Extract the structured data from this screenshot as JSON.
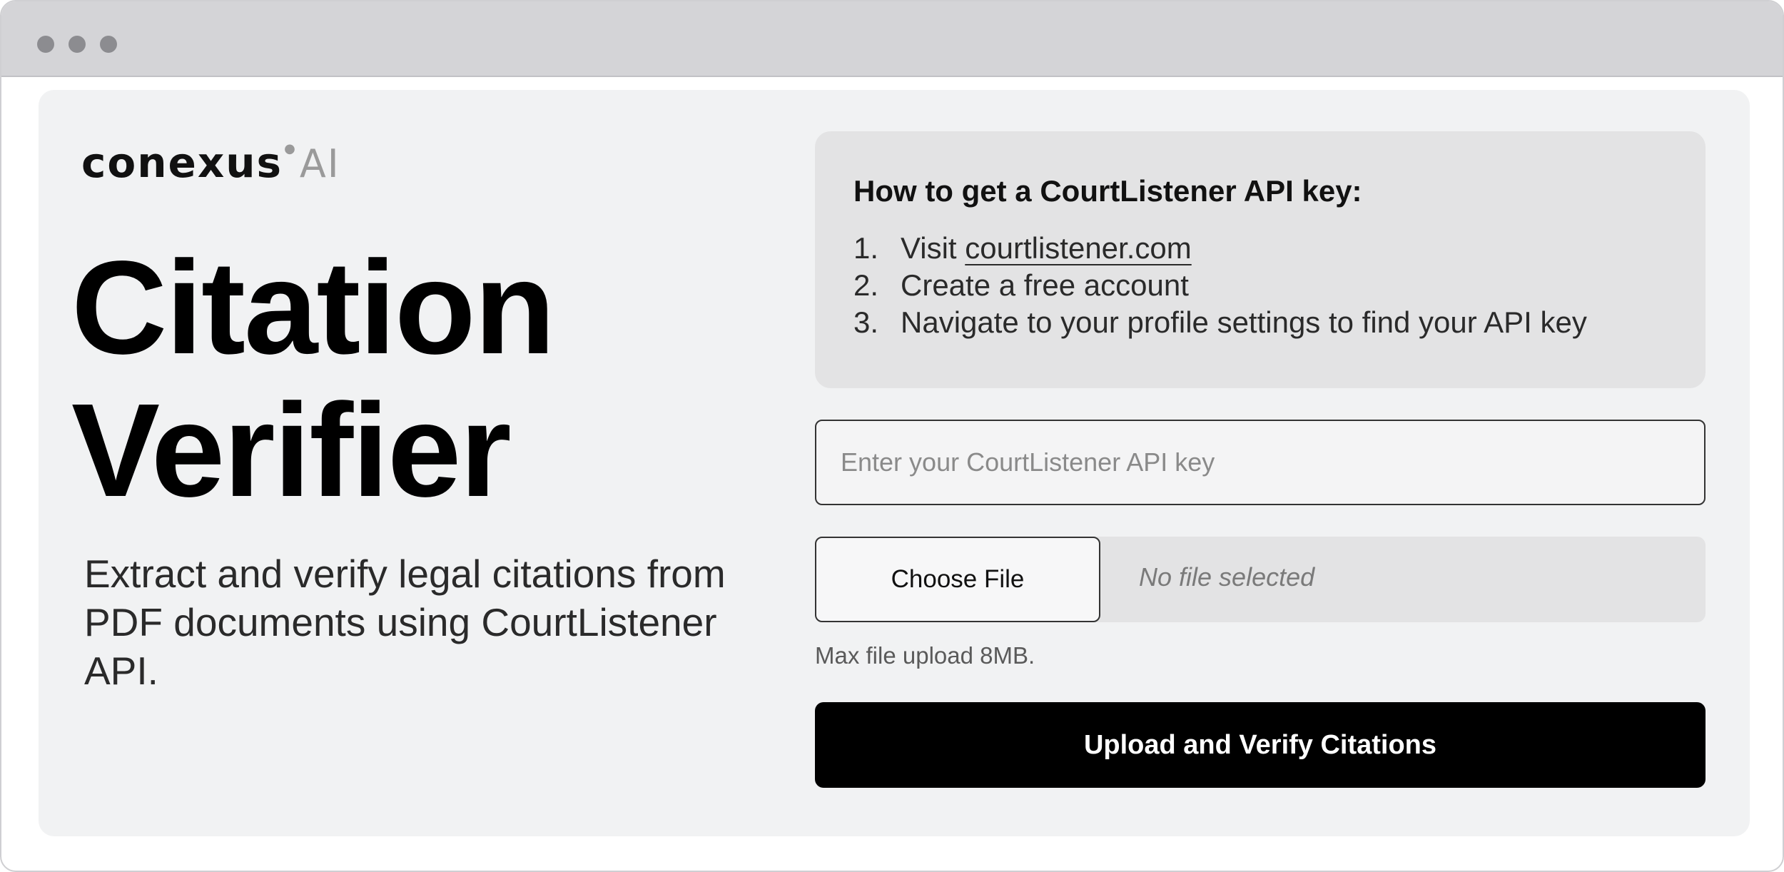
{
  "brand": {
    "logo_word": "conexus",
    "logo_suffix": "AI"
  },
  "hero": {
    "title_line1": "Citation",
    "title_line2": "Verifier",
    "subtitle": "Extract and verify legal citations from PDF documents using CourtListener API."
  },
  "instructions": {
    "heading": "How to get a CourtListener API key:",
    "steps": [
      {
        "num": "1.",
        "prefix": "Visit ",
        "link": "courtlistener.com"
      },
      {
        "num": "2.",
        "text": "Create a free account"
      },
      {
        "num": "3.",
        "text": "Navigate to your profile settings to find your API key"
      }
    ]
  },
  "form": {
    "api_key_placeholder": "Enter your CourtListener API key",
    "api_key_value": "",
    "choose_file_label": "Choose File",
    "file_status": "No file selected",
    "max_upload_note": "Max file upload 8MB.",
    "submit_label": "Upload and Verify Citations"
  },
  "colors": {
    "card_background": "#f1f2f3",
    "info_box_background": "#e3e3e4",
    "primary_button": "#000000",
    "titlebar": "#d4d4d7"
  }
}
